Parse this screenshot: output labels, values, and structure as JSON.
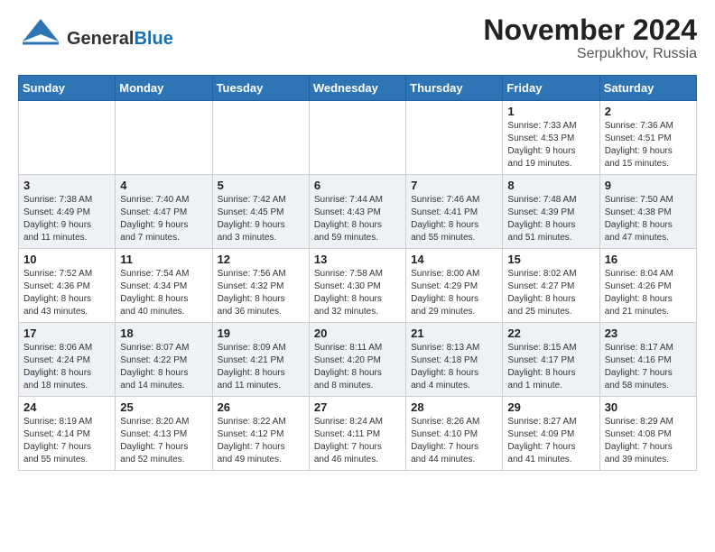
{
  "header": {
    "logo_general": "General",
    "logo_blue": "Blue",
    "title": "November 2024",
    "subtitle": "Serpukhov, Russia"
  },
  "weekdays": [
    "Sunday",
    "Monday",
    "Tuesday",
    "Wednesday",
    "Thursday",
    "Friday",
    "Saturday"
  ],
  "weeks": [
    [
      {
        "day": "",
        "info": ""
      },
      {
        "day": "",
        "info": ""
      },
      {
        "day": "",
        "info": ""
      },
      {
        "day": "",
        "info": ""
      },
      {
        "day": "",
        "info": ""
      },
      {
        "day": "1",
        "info": "Sunrise: 7:33 AM\nSunset: 4:53 PM\nDaylight: 9 hours\nand 19 minutes."
      },
      {
        "day": "2",
        "info": "Sunrise: 7:36 AM\nSunset: 4:51 PM\nDaylight: 9 hours\nand 15 minutes."
      }
    ],
    [
      {
        "day": "3",
        "info": "Sunrise: 7:38 AM\nSunset: 4:49 PM\nDaylight: 9 hours\nand 11 minutes."
      },
      {
        "day": "4",
        "info": "Sunrise: 7:40 AM\nSunset: 4:47 PM\nDaylight: 9 hours\nand 7 minutes."
      },
      {
        "day": "5",
        "info": "Sunrise: 7:42 AM\nSunset: 4:45 PM\nDaylight: 9 hours\nand 3 minutes."
      },
      {
        "day": "6",
        "info": "Sunrise: 7:44 AM\nSunset: 4:43 PM\nDaylight: 8 hours\nand 59 minutes."
      },
      {
        "day": "7",
        "info": "Sunrise: 7:46 AM\nSunset: 4:41 PM\nDaylight: 8 hours\nand 55 minutes."
      },
      {
        "day": "8",
        "info": "Sunrise: 7:48 AM\nSunset: 4:39 PM\nDaylight: 8 hours\nand 51 minutes."
      },
      {
        "day": "9",
        "info": "Sunrise: 7:50 AM\nSunset: 4:38 PM\nDaylight: 8 hours\nand 47 minutes."
      }
    ],
    [
      {
        "day": "10",
        "info": "Sunrise: 7:52 AM\nSunset: 4:36 PM\nDaylight: 8 hours\nand 43 minutes."
      },
      {
        "day": "11",
        "info": "Sunrise: 7:54 AM\nSunset: 4:34 PM\nDaylight: 8 hours\nand 40 minutes."
      },
      {
        "day": "12",
        "info": "Sunrise: 7:56 AM\nSunset: 4:32 PM\nDaylight: 8 hours\nand 36 minutes."
      },
      {
        "day": "13",
        "info": "Sunrise: 7:58 AM\nSunset: 4:30 PM\nDaylight: 8 hours\nand 32 minutes."
      },
      {
        "day": "14",
        "info": "Sunrise: 8:00 AM\nSunset: 4:29 PM\nDaylight: 8 hours\nand 29 minutes."
      },
      {
        "day": "15",
        "info": "Sunrise: 8:02 AM\nSunset: 4:27 PM\nDaylight: 8 hours\nand 25 minutes."
      },
      {
        "day": "16",
        "info": "Sunrise: 8:04 AM\nSunset: 4:26 PM\nDaylight: 8 hours\nand 21 minutes."
      }
    ],
    [
      {
        "day": "17",
        "info": "Sunrise: 8:06 AM\nSunset: 4:24 PM\nDaylight: 8 hours\nand 18 minutes."
      },
      {
        "day": "18",
        "info": "Sunrise: 8:07 AM\nSunset: 4:22 PM\nDaylight: 8 hours\nand 14 minutes."
      },
      {
        "day": "19",
        "info": "Sunrise: 8:09 AM\nSunset: 4:21 PM\nDaylight: 8 hours\nand 11 minutes."
      },
      {
        "day": "20",
        "info": "Sunrise: 8:11 AM\nSunset: 4:20 PM\nDaylight: 8 hours\nand 8 minutes."
      },
      {
        "day": "21",
        "info": "Sunrise: 8:13 AM\nSunset: 4:18 PM\nDaylight: 8 hours\nand 4 minutes."
      },
      {
        "day": "22",
        "info": "Sunrise: 8:15 AM\nSunset: 4:17 PM\nDaylight: 8 hours\nand 1 minute."
      },
      {
        "day": "23",
        "info": "Sunrise: 8:17 AM\nSunset: 4:16 PM\nDaylight: 7 hours\nand 58 minutes."
      }
    ],
    [
      {
        "day": "24",
        "info": "Sunrise: 8:19 AM\nSunset: 4:14 PM\nDaylight: 7 hours\nand 55 minutes."
      },
      {
        "day": "25",
        "info": "Sunrise: 8:20 AM\nSunset: 4:13 PM\nDaylight: 7 hours\nand 52 minutes."
      },
      {
        "day": "26",
        "info": "Sunrise: 8:22 AM\nSunset: 4:12 PM\nDaylight: 7 hours\nand 49 minutes."
      },
      {
        "day": "27",
        "info": "Sunrise: 8:24 AM\nSunset: 4:11 PM\nDaylight: 7 hours\nand 46 minutes."
      },
      {
        "day": "28",
        "info": "Sunrise: 8:26 AM\nSunset: 4:10 PM\nDaylight: 7 hours\nand 44 minutes."
      },
      {
        "day": "29",
        "info": "Sunrise: 8:27 AM\nSunset: 4:09 PM\nDaylight: 7 hours\nand 41 minutes."
      },
      {
        "day": "30",
        "info": "Sunrise: 8:29 AM\nSunset: 4:08 PM\nDaylight: 7 hours\nand 39 minutes."
      }
    ]
  ]
}
